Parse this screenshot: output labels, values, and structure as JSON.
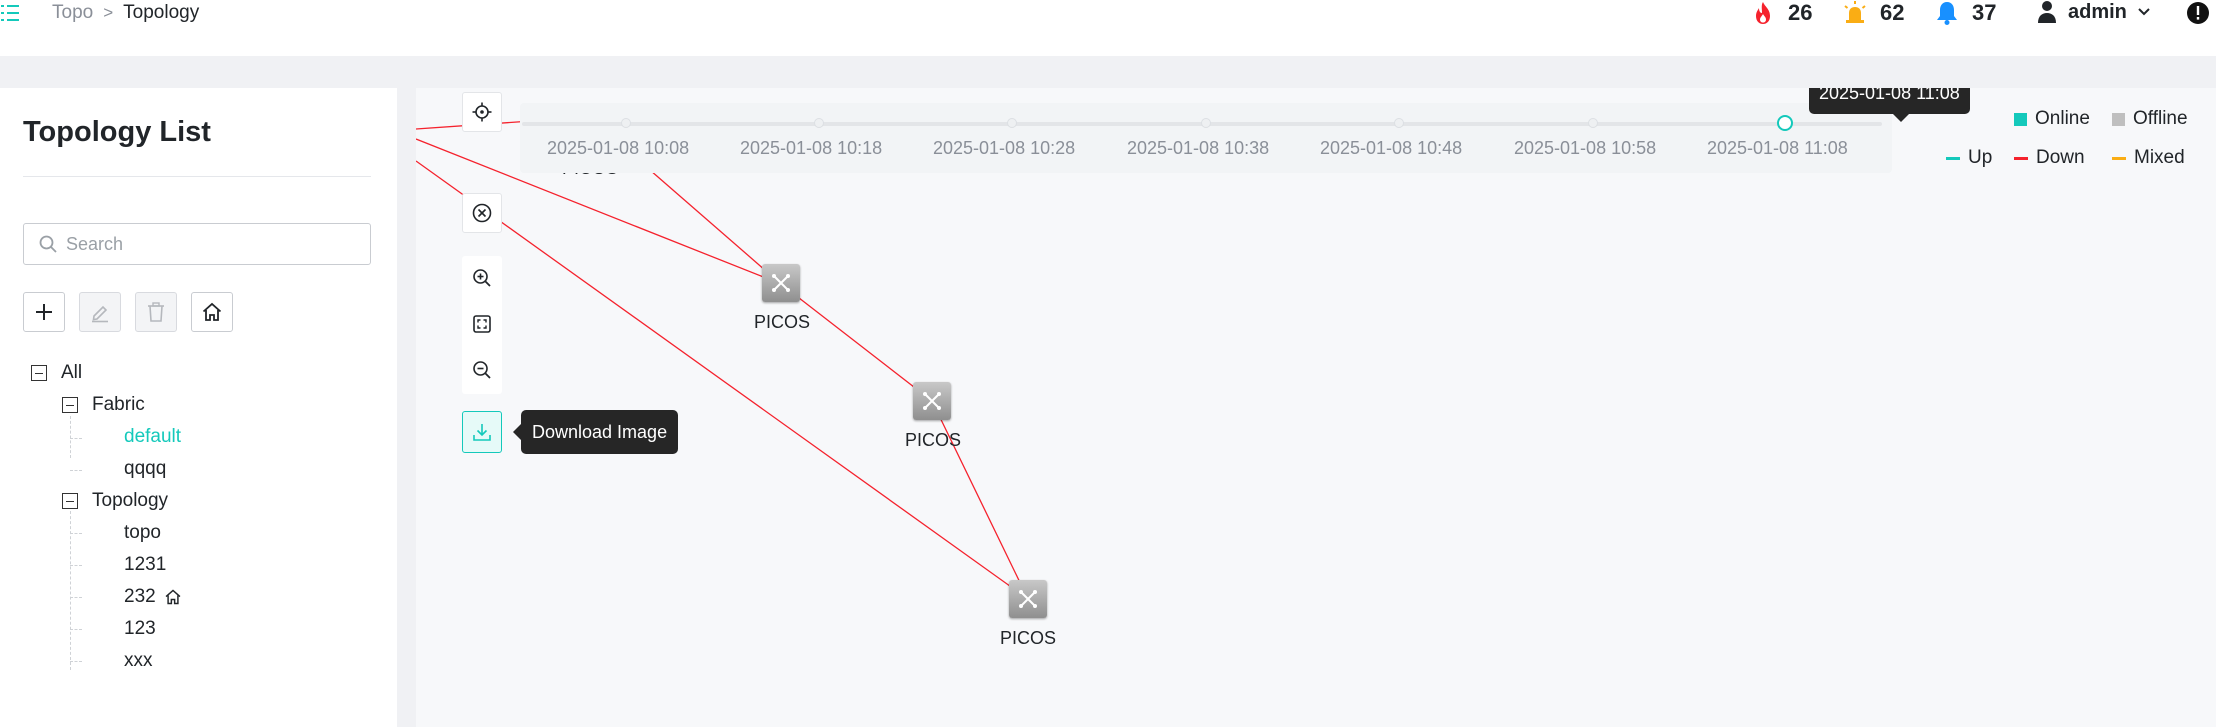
{
  "header": {
    "breadcrumb": [
      "Topo",
      "Topology"
    ],
    "breadcrumb_separator": ">",
    "stats": {
      "critical": "26",
      "warning": "62",
      "notification": "37"
    },
    "user_label": "admin"
  },
  "sidebar": {
    "title": "Topology List",
    "search_placeholder": "Search",
    "tree": {
      "root": "All",
      "fabric": {
        "label": "Fabric",
        "children": [
          "default",
          "qqqq"
        ]
      },
      "topology": {
        "label": "Topology",
        "children": [
          "topo",
          "1231",
          "232",
          "123",
          "xxx"
        ]
      }
    }
  },
  "canvas": {
    "timeline": {
      "labels": [
        "2025-01-08 10:08",
        "2025-01-08 10:18",
        "2025-01-08 10:28",
        "2025-01-08 10:38",
        "2025-01-08 10:48",
        "2025-01-08 10:58",
        "2025-01-08 11:08"
      ],
      "selected_tooltip": "2025-01-08 11:08"
    },
    "download_tooltip": "Download Image",
    "node_label": "PICOS",
    "legend": {
      "online": "Online",
      "offline": "Offline",
      "up": "Up",
      "down": "Down",
      "mixed": "Mixed"
    }
  },
  "colors": {
    "accent": "#14c9bb",
    "online": "#14c9bb",
    "offline": "#bfbfbf",
    "up": "#14c9bb",
    "down": "#f5222d",
    "mixed": "#faad14",
    "alarm_critical": "#f5222d",
    "alarm_warning": "#faad14",
    "alarm_info": "#1890ff"
  }
}
